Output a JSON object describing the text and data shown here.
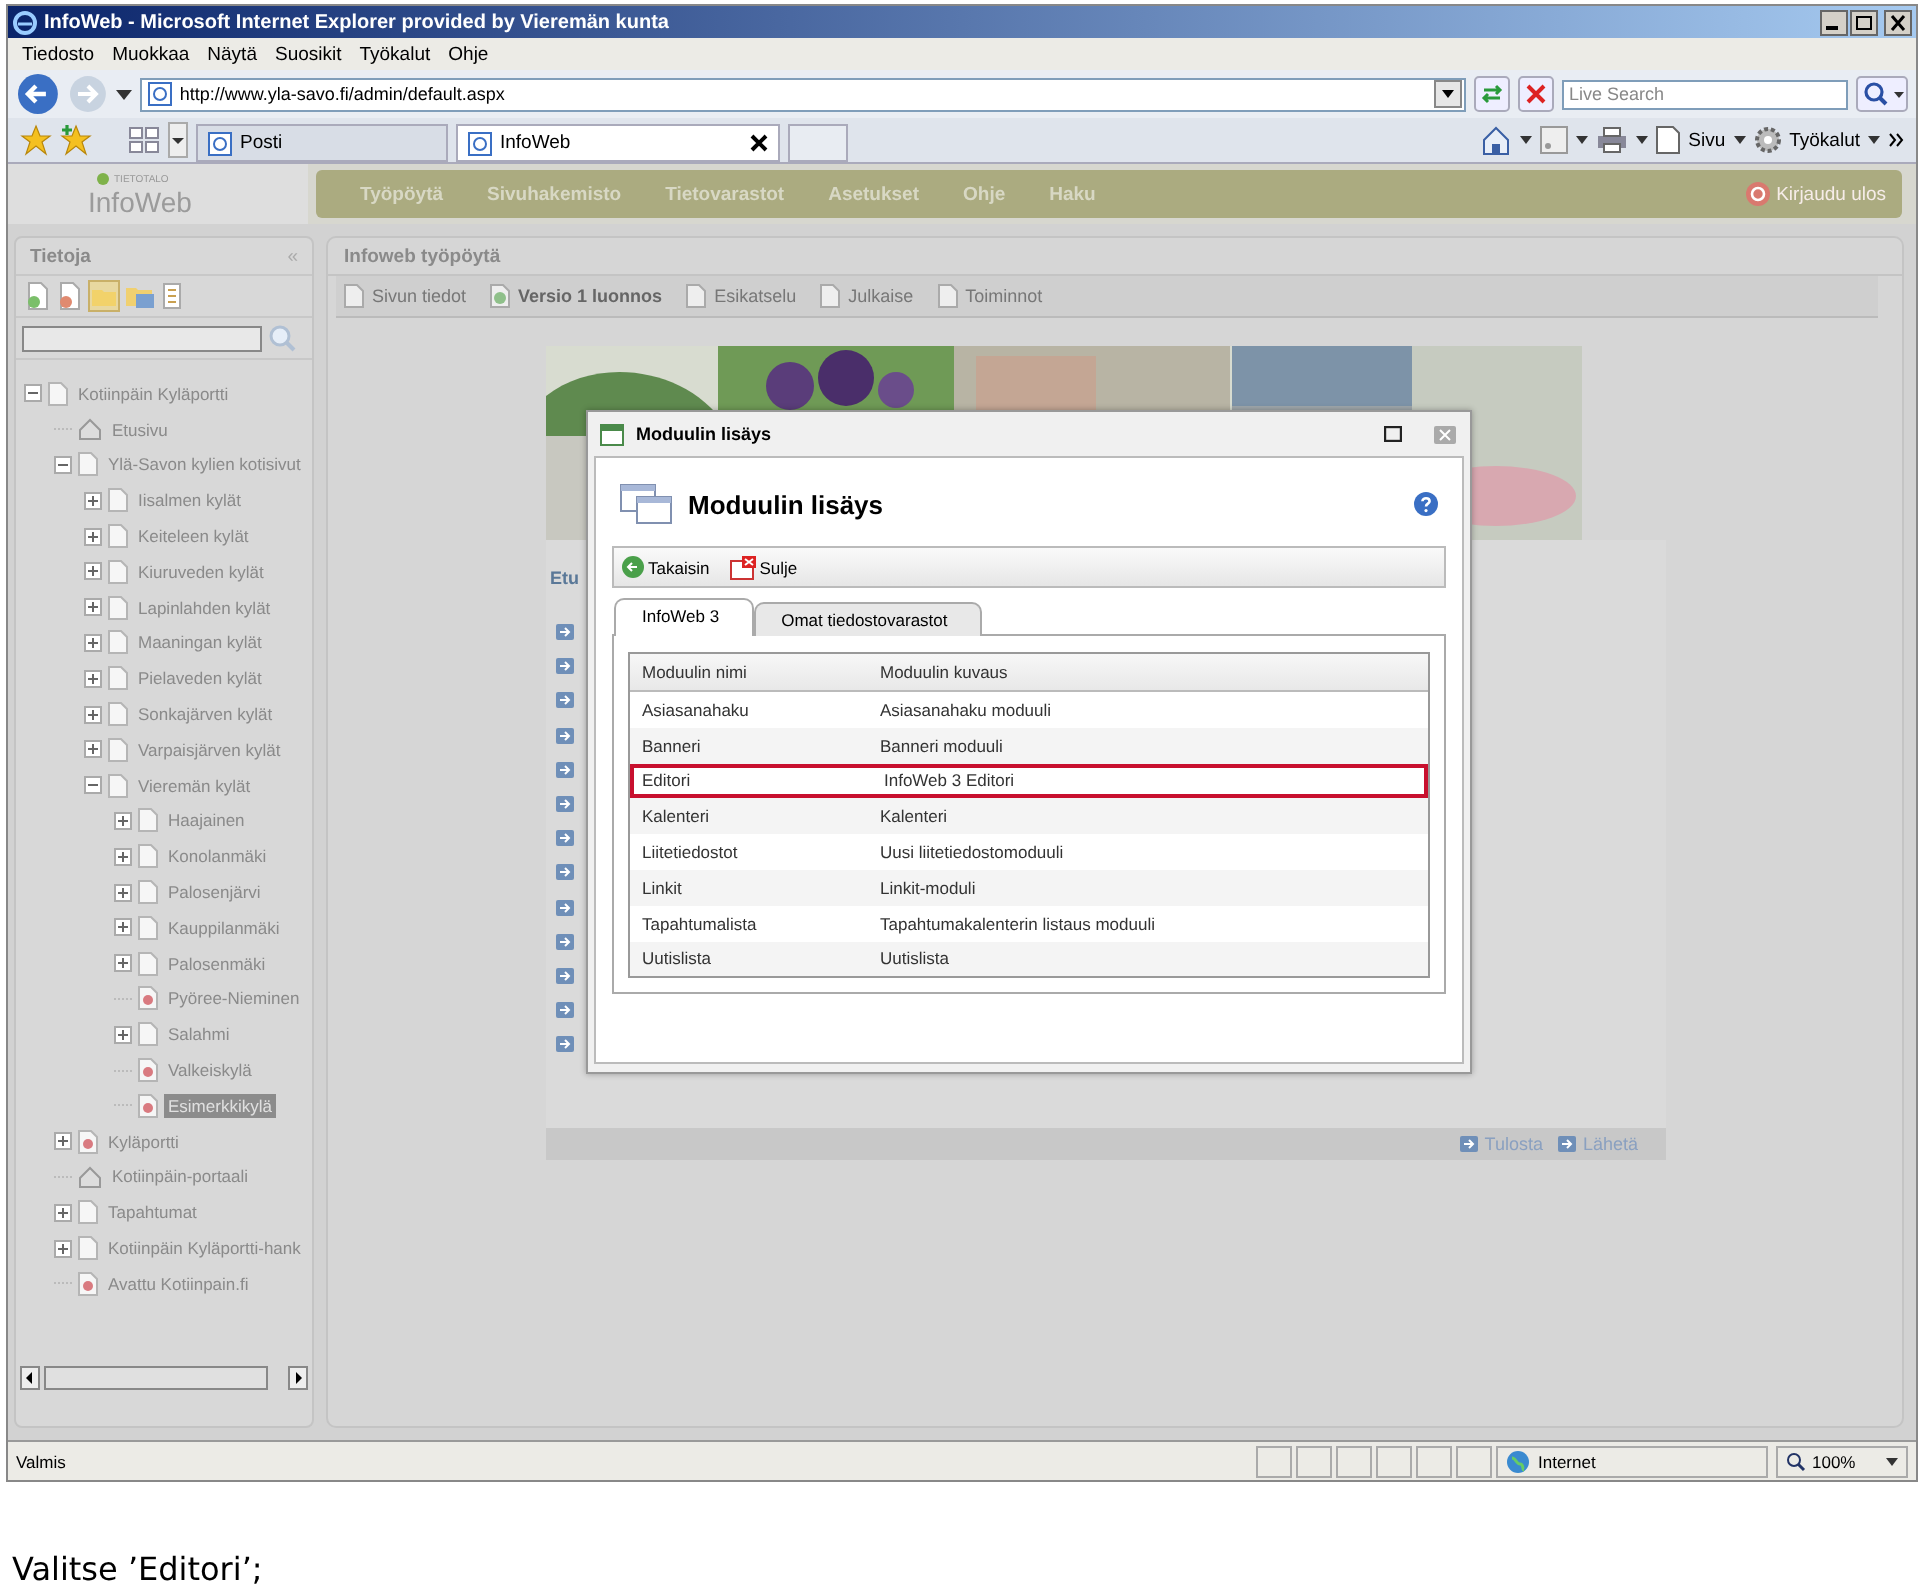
{
  "window": {
    "title": "InfoWeb - Microsoft Internet Explorer provided by Vieremän kunta"
  },
  "menu": [
    "Tiedosto",
    "Muokkaa",
    "Näytä",
    "Suosikit",
    "Työkalut",
    "Ohje"
  ],
  "address": {
    "url": "http://www.yla-savo.fi/admin/default.aspx"
  },
  "search": {
    "placeholder": "Live Search"
  },
  "browser_tabs": [
    {
      "label": "Posti",
      "selected": false
    },
    {
      "label": "InfoWeb",
      "selected": true
    }
  ],
  "command_bar": [
    "Sivu",
    "Työkalut"
  ],
  "app_header": {
    "brand_small": "TIETOTALO",
    "brand": "InfoWeb",
    "nav": [
      "Työpöytä",
      "Sivuhakemisto",
      "Tietovarastot",
      "Asetukset",
      "Ohje",
      "Haku"
    ],
    "logout": "Kirjaudu ulos"
  },
  "sidebar": {
    "title": "Tietoja",
    "collapse": "«",
    "tree": [
      {
        "label": "Kotiinpäin Kyläportti",
        "expanded": true,
        "kind": "page",
        "selected": false,
        "children": [
          {
            "label": "Etusivu",
            "kind": "home",
            "selected": false
          },
          {
            "label": "Ylä-Savon kylien kotisivut",
            "expanded": true,
            "kind": "page",
            "selected": false,
            "children": [
              {
                "label": "Iisalmen kylät",
                "expanded": false,
                "kind": "page",
                "selected": false
              },
              {
                "label": "Keiteleen kylät",
                "expanded": false,
                "kind": "page",
                "selected": false
              },
              {
                "label": "Kiuruveden kylät",
                "expanded": false,
                "kind": "page",
                "selected": false
              },
              {
                "label": "Lapinlahden kylät",
                "expanded": false,
                "kind": "page",
                "selected": false
              },
              {
                "label": "Maaningan kylät",
                "expanded": false,
                "kind": "page",
                "selected": false
              },
              {
                "label": "Pielaveden kylät",
                "expanded": false,
                "kind": "page",
                "selected": false
              },
              {
                "label": "Sonkajärven kylät",
                "expanded": false,
                "kind": "page",
                "selected": false
              },
              {
                "label": "Varpaisjärven kylät",
                "expanded": false,
                "kind": "page",
                "selected": false
              },
              {
                "label": "Vieremän kylät",
                "expanded": true,
                "kind": "page",
                "selected": false,
                "children": [
                  {
                    "label": "Haajainen",
                    "expanded": false,
                    "kind": "page",
                    "selected": false
                  },
                  {
                    "label": "Konolanmäki",
                    "expanded": false,
                    "kind": "page",
                    "selected": false
                  },
                  {
                    "label": "Palosenjärvi",
                    "expanded": false,
                    "kind": "page",
                    "selected": false
                  },
                  {
                    "label": "Kauppilanmäki",
                    "expanded": false,
                    "kind": "page",
                    "selected": false
                  },
                  {
                    "label": "Palosenmäki",
                    "expanded": false,
                    "kind": "page",
                    "selected": false
                  },
                  {
                    "label": "Pyöree-Nieminen",
                    "kind": "locked",
                    "selected": false
                  },
                  {
                    "label": "Salahmi",
                    "expanded": false,
                    "kind": "page",
                    "selected": false
                  },
                  {
                    "label": "Valkeiskylä",
                    "kind": "locked",
                    "selected": false
                  },
                  {
                    "label": "Esimerkkikylä",
                    "kind": "locked",
                    "selected": true
                  }
                ]
              }
            ]
          },
          {
            "label": "Kyläportti",
            "expanded": false,
            "kind": "locked",
            "selected": false
          },
          {
            "label": "Kotiinpäin-portaali",
            "kind": "home",
            "selected": false
          },
          {
            "label": "Tapahtumat",
            "expanded": false,
            "kind": "page",
            "selected": false
          },
          {
            "label": "Kotiinpäin Kyläportti-hank",
            "expanded": false,
            "kind": "page",
            "selected": false
          },
          {
            "label": "Avattu Kotiinpain.fi",
            "kind": "locked",
            "selected": false
          }
        ]
      }
    ]
  },
  "workspace": {
    "title": "Infoweb työpöytä",
    "toolbar": [
      {
        "label": "Sivun tiedot",
        "bold": false
      },
      {
        "label": "Versio 1 luonnos",
        "bold": true
      },
      {
        "label": "Esikatselu",
        "bold": false
      },
      {
        "label": "Julkaise",
        "bold": false
      },
      {
        "label": "Toiminnot",
        "bold": false
      }
    ],
    "content_tab": "Etu",
    "footer_links": [
      "Tulosta",
      "Lähetä"
    ]
  },
  "dialog": {
    "title": "Moduulin lisäys",
    "heading": "Moduulin lisäys",
    "buttons": [
      "Takaisin",
      "Sulje"
    ],
    "tabs": [
      {
        "label": "InfoWeb 3",
        "selected": true
      },
      {
        "label": "Omat tiedostovarastot",
        "selected": false
      }
    ],
    "columns": [
      "Moduulin nimi",
      "Moduulin kuvaus"
    ],
    "rows": [
      {
        "name": "Asiasanahaku",
        "description": "Asiasanahaku moduuli",
        "selected": false
      },
      {
        "name": "Banneri",
        "description": "Banneri moduuli",
        "selected": false
      },
      {
        "name": "Editori",
        "description": "InfoWeb 3 Editori",
        "selected": true
      },
      {
        "name": "Kalenteri",
        "description": "Kalenteri",
        "selected": false
      },
      {
        "name": "Liitetiedostot",
        "description": "Uusi liitetiedostomoduuli",
        "selected": false
      },
      {
        "name": "Linkit",
        "description": "Linkit-moduli",
        "selected": false
      },
      {
        "name": "Tapahtumalista",
        "description": "Tapahtumakalenterin listaus moduuli",
        "selected": false
      },
      {
        "name": "Uutislista",
        "description": "Uutislista",
        "selected": false
      }
    ]
  },
  "status_bar": {
    "text": "Valmis",
    "zone": "Internet",
    "zoom": "100%"
  },
  "caption": "Valitse ’Editori’;"
}
